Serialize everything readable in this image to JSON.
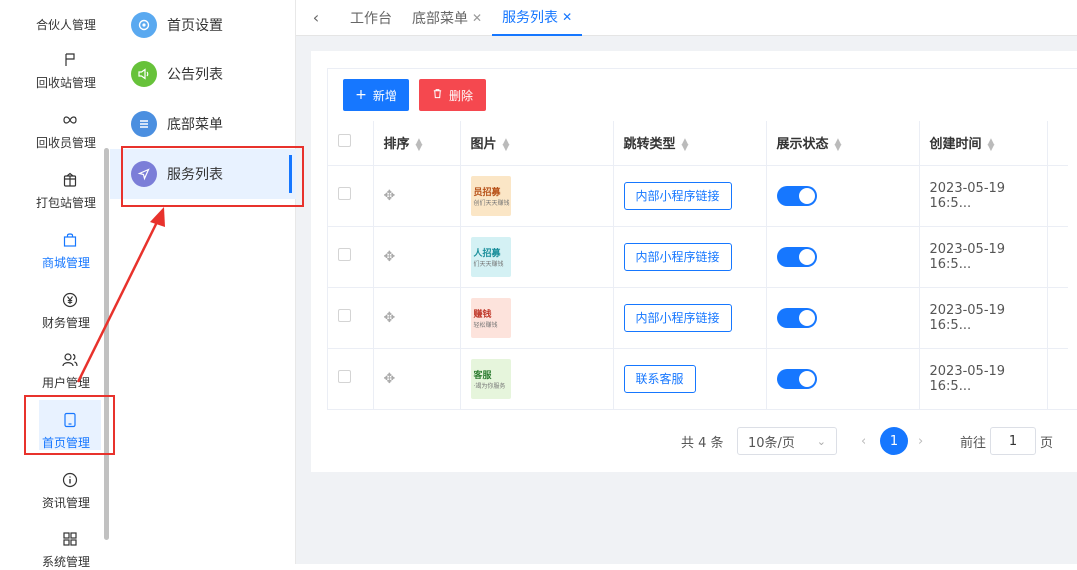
{
  "rail": {
    "items": [
      {
        "label": "合伙人管理",
        "icon": "handshake-icon"
      },
      {
        "label": "回收站管理",
        "icon": "flag-icon"
      },
      {
        "label": "回收员管理",
        "icon": "infinity-icon"
      },
      {
        "label": "打包站管理",
        "icon": "box-icon"
      },
      {
        "label": "商城管理",
        "icon": "shopping-bag-icon"
      },
      {
        "label": "财务管理",
        "icon": "yen-icon"
      },
      {
        "label": "用户管理",
        "icon": "users-icon"
      },
      {
        "label": "首页管理",
        "icon": "tablet-icon"
      },
      {
        "label": "资讯管理",
        "icon": "info-icon"
      },
      {
        "label": "系统管理",
        "icon": "grid-icon"
      }
    ]
  },
  "submenu": {
    "items": [
      {
        "label": "首页设置",
        "icon": "settings-icon",
        "color": "#5aa9f0"
      },
      {
        "label": "公告列表",
        "icon": "speaker-icon",
        "color": "#67c23a"
      },
      {
        "label": "底部菜单",
        "icon": "menu-icon",
        "color": "#4b8fe0"
      },
      {
        "label": "服务列表",
        "icon": "send-icon",
        "color": "#7b7ed8"
      }
    ]
  },
  "tabs": [
    {
      "label": "工作台",
      "closable": false
    },
    {
      "label": "底部菜单",
      "closable": true
    },
    {
      "label": "服务列表",
      "closable": true
    }
  ],
  "toolbar": {
    "add_label": "新增",
    "delete_label": "删除"
  },
  "table": {
    "columns": [
      "排序",
      "图片",
      "跳转类型",
      "展示状态",
      "创建时间"
    ],
    "rows": [
      {
        "img_title": "员招募",
        "img_sub": "创们天天赚钱",
        "img_bg": "#fbe6c6",
        "jump_type": "内部小程序链接",
        "status": true,
        "created": "2023-05-19 16:5..."
      },
      {
        "img_title": "人招募",
        "img_sub": "们天天赚钱",
        "img_bg": "#d4f1f4",
        "jump_type": "内部小程序链接",
        "status": true,
        "created": "2023-05-19 16:5..."
      },
      {
        "img_title": "赚钱",
        "img_sub": "轻松赚钱",
        "img_bg": "#fde3dc",
        "jump_type": "内部小程序链接",
        "status": true,
        "created": "2023-05-19 16:5..."
      },
      {
        "img_title": "客服",
        "img_sub": "·竭为你服务",
        "img_bg": "#e6f5dc",
        "jump_type": "联系客服",
        "status": true,
        "created": "2023-05-19 16:5..."
      }
    ]
  },
  "pagination": {
    "total": "共 4 条",
    "page_size": "10条/页",
    "current": "1",
    "goto_label": "前往",
    "goto_value": "1",
    "page_label": "页"
  },
  "colors": {
    "accent": "#1677ff",
    "danger": "#f5484f",
    "highlight": "#e8322c"
  }
}
